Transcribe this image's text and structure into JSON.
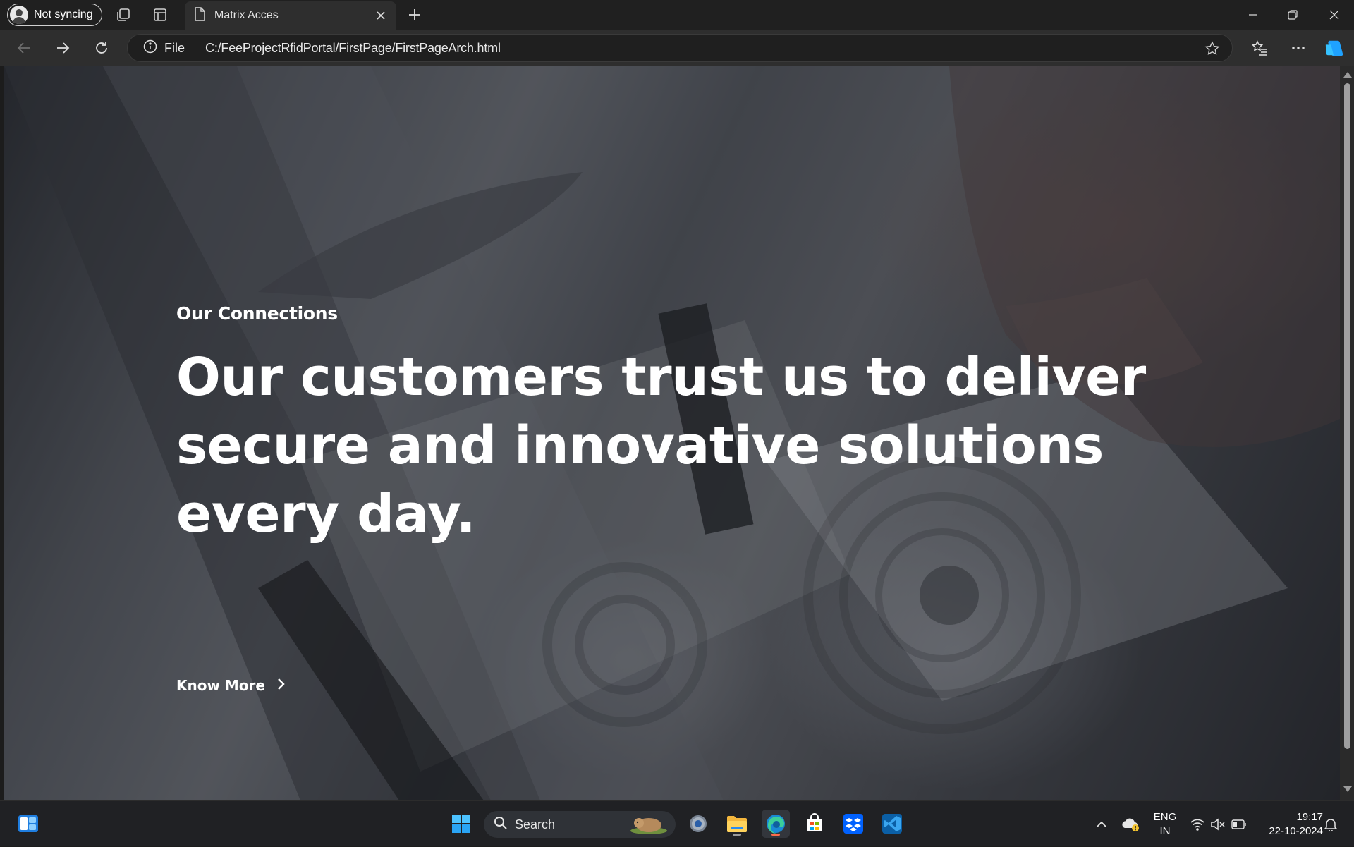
{
  "browser": {
    "profile_label": "Not syncing",
    "tab_title": "Matrix Acces",
    "address_scheme": "File",
    "address_url": "C:/FeeProjectRfidPortal/FirstPage/FirstPageArch.html"
  },
  "hero": {
    "eyebrow": "Our Connections",
    "title": "Our customers trust us to deliver secure and innovative solutions every day.",
    "cta_label": "Know More"
  },
  "taskbar": {
    "search_label": "Search",
    "language_line1": "ENG",
    "language_line2": "IN",
    "time": "19:17",
    "date": "22-10-2024"
  },
  "colors": {
    "accent_blue": "#0a84ff",
    "edge_active_indicator": "#ff6b4a",
    "file_explorer_indicator": "#9a9a9a"
  },
  "icons": {
    "titlebar": [
      "profile-icon",
      "workspaces-icon",
      "tab-actions-icon",
      "page-icon",
      "close-icon",
      "plus-icon",
      "minimize-icon",
      "restore-icon",
      "window-close-icon"
    ],
    "navbar": [
      "back-arrow-icon",
      "forward-arrow-icon",
      "refresh-icon",
      "info-icon",
      "star-icon",
      "favorites-icon",
      "more-icon",
      "copilot-icon"
    ],
    "taskbar": [
      "widgets-icon",
      "windows-start-icon",
      "search-icon",
      "settings-icon",
      "file-explorer-icon",
      "edge-icon",
      "store-icon",
      "dropbox-icon",
      "vscode-icon",
      "chevron-up-icon",
      "onedrive-icon",
      "wifi-icon",
      "speaker-muted-icon",
      "battery-icon",
      "notification-bell-icon"
    ]
  }
}
